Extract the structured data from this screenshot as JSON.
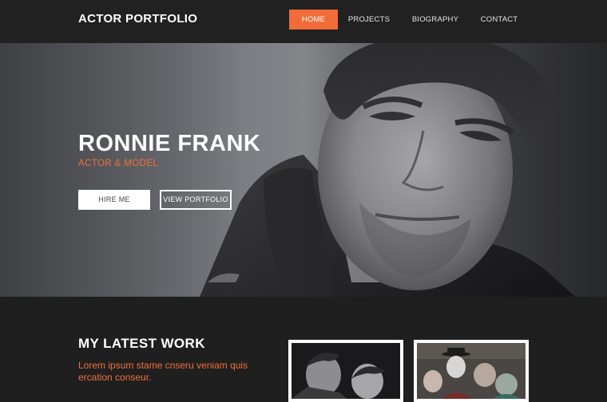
{
  "header": {
    "logo": "ACTOR PORTFOLIO",
    "nav": [
      {
        "label": "HOME",
        "active": true
      },
      {
        "label": "PROJECTS",
        "active": false
      },
      {
        "label": "BIOGRAPHY",
        "active": false
      },
      {
        "label": "CONTACT",
        "active": false
      }
    ]
  },
  "hero": {
    "name": "RONNIE FRANK",
    "subtitle": "ACTOR & MODEL",
    "buttons": {
      "hire": "HIRE ME",
      "portfolio": "VIEW PORTFOLIO"
    }
  },
  "latest_work": {
    "heading": "MY LATEST WORK",
    "text": "Lorem ipsum stame cnseru veniam quis ercation conseur."
  },
  "colors": {
    "accent": "#f26c3a",
    "background": "#1f1f20",
    "header": "#212122"
  }
}
